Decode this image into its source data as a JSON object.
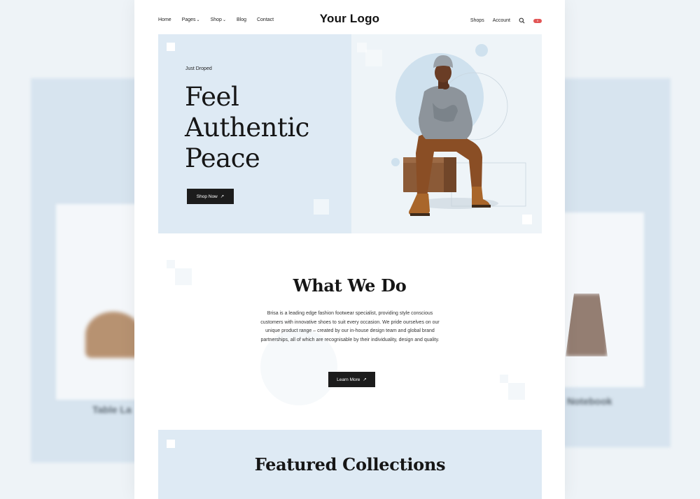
{
  "background": {
    "left_caption": "Table La",
    "right_caption": "Notebook"
  },
  "nav": {
    "links": [
      "Home",
      "Pages",
      "Shop",
      "Blog",
      "Contact"
    ],
    "logo": "Your Logo",
    "right_links": [
      "Shops",
      "Account"
    ],
    "cart_count": "0",
    "chevron": "⌄"
  },
  "hero": {
    "eyebrow": "Just Droped",
    "title_line1": "Feel",
    "title_line2": "Authentic",
    "title_line3": "Peace",
    "button_label": "Shop Now",
    "button_arrow": "↗"
  },
  "what_we_do": {
    "title": "What We Do",
    "body": "Brisa is a leading edge fashion footwear specialist, providing style conscious customers with innovative shoes to suit every occasion. We pride ourselves on our unique product range – created by our in-house design team and global brand partnerships, all of which are recognisable by their individuality, design and quality.",
    "button_label": "Learn More",
    "button_arrow": "↗"
  },
  "featured": {
    "title": "Featured Collections"
  },
  "colors": {
    "hero_bg": "#deeaf4",
    "accent_circle": "#cfe1ee",
    "button": "#1c1c1c",
    "badge": "#e25555"
  }
}
